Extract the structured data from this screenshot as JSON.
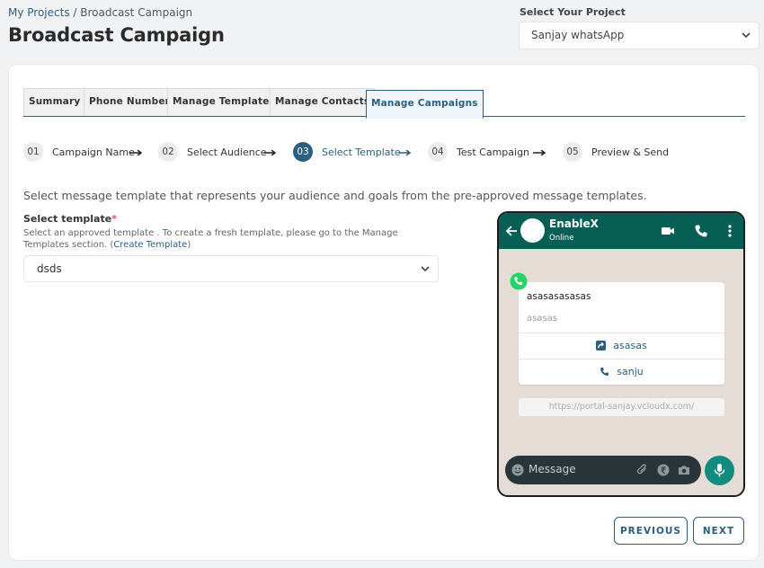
{
  "breadcrumb": {
    "link": "My Projects",
    "separator": " / ",
    "current": "Broadcast Campaign"
  },
  "page_title": "Broadcast Campaign",
  "project": {
    "label": "Select Your Project",
    "selected": "Sanjay whatsApp"
  },
  "tabs": [
    {
      "label": "Summary"
    },
    {
      "label": "Phone Number"
    },
    {
      "label": "Manage Templates"
    },
    {
      "label": "Manage Contacts"
    },
    {
      "label": "Manage Campaigns"
    }
  ],
  "steps": [
    {
      "num": "01",
      "label": "Campaign Name"
    },
    {
      "num": "02",
      "label": "Select Audience"
    },
    {
      "num": "03",
      "label": "Select Template"
    },
    {
      "num": "04",
      "label": "Test Campaign"
    },
    {
      "num": "05",
      "label": "Preview & Send"
    }
  ],
  "intro": "Select message template that represents your audience and goals from the pre-approved message templates.",
  "template": {
    "label": "Select template",
    "required_mark": "*",
    "helper_before": "Select an approved template . To create a fresh template, please go to the Manage Templates section. (",
    "helper_link": "Create Template",
    "helper_after": ")",
    "selected": "dsds"
  },
  "preview": {
    "contact_name": "EnableX",
    "contact_status": "Online",
    "message_title": "asasasasasas",
    "message_footer": "asasas",
    "button_url_label": "asasas",
    "button_phone_label": "sanju",
    "url": "https://portal-sanjay.vcloudx.com/",
    "input_placeholder": "Message"
  },
  "actions": {
    "previous": "PREVIOUS",
    "next": "NEXT"
  },
  "colors": {
    "accent": "#2c5f7d",
    "whatsapp_header": "#075e54",
    "whatsapp_green": "#128c7e",
    "whatsapp_logo": "#25d366"
  }
}
